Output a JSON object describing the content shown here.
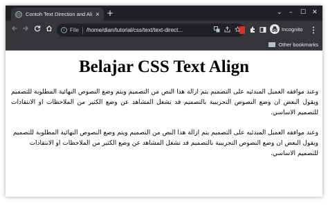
{
  "browser": {
    "tab_title": "Contoh Text Direction and Ali",
    "tab_close": "×",
    "new_tab": "+",
    "window_controls": {
      "minimize": "–",
      "maximize": "☐",
      "close": "✕",
      "tab_search": "⌄"
    },
    "omnibox": {
      "scheme_label": "File",
      "url": "/home/dian/tutorial/css/text/text-direct..."
    },
    "profile_label": "Incognito",
    "bookmarks": {
      "other_label": "Other bookmarks"
    }
  },
  "page": {
    "heading": "Belajar CSS Text Align",
    "paragraphs": [
      "وعند موافقه العميل المبدئيه على التصميم يتم ازالة هذا النص من التصميم ويتم وضع النصوص النهائية المطلوبة للتصميم ويقول البعض ان وضع النصوص التجريبية بالتصميم قد تشغل المشاهد عن وضع الكثير من الملاحظات او الانتقادات للتصميم الاساسي.",
      "وعند موافقه العميل المبدئيه على التصميم يتم ازالة هذا النص من التصميم ويتم وضع النصوص النهائية المطلوبة للتصميم ويقول البعض ان وضع النصوص التجريبية بالتصميم قد تشغل المشاهد عن وضع الكثير من الملاحظات او الانتقادات للتصميم الاساسي."
    ]
  },
  "icons": [
    "globe-icon",
    "back-icon",
    "forward-icon",
    "reload-icon",
    "home-icon",
    "info-icon",
    "translate-icon",
    "share-icon",
    "star-icon",
    "extension-icon",
    "puzzle-icon",
    "sidepanel-icon",
    "incognito-icon",
    "menu-icon",
    "folder-icon"
  ],
  "colors": {
    "titlebar": "#202124",
    "toolbar": "#35363a",
    "omnibox": "#202124",
    "text_light": "#e8eaed"
  }
}
